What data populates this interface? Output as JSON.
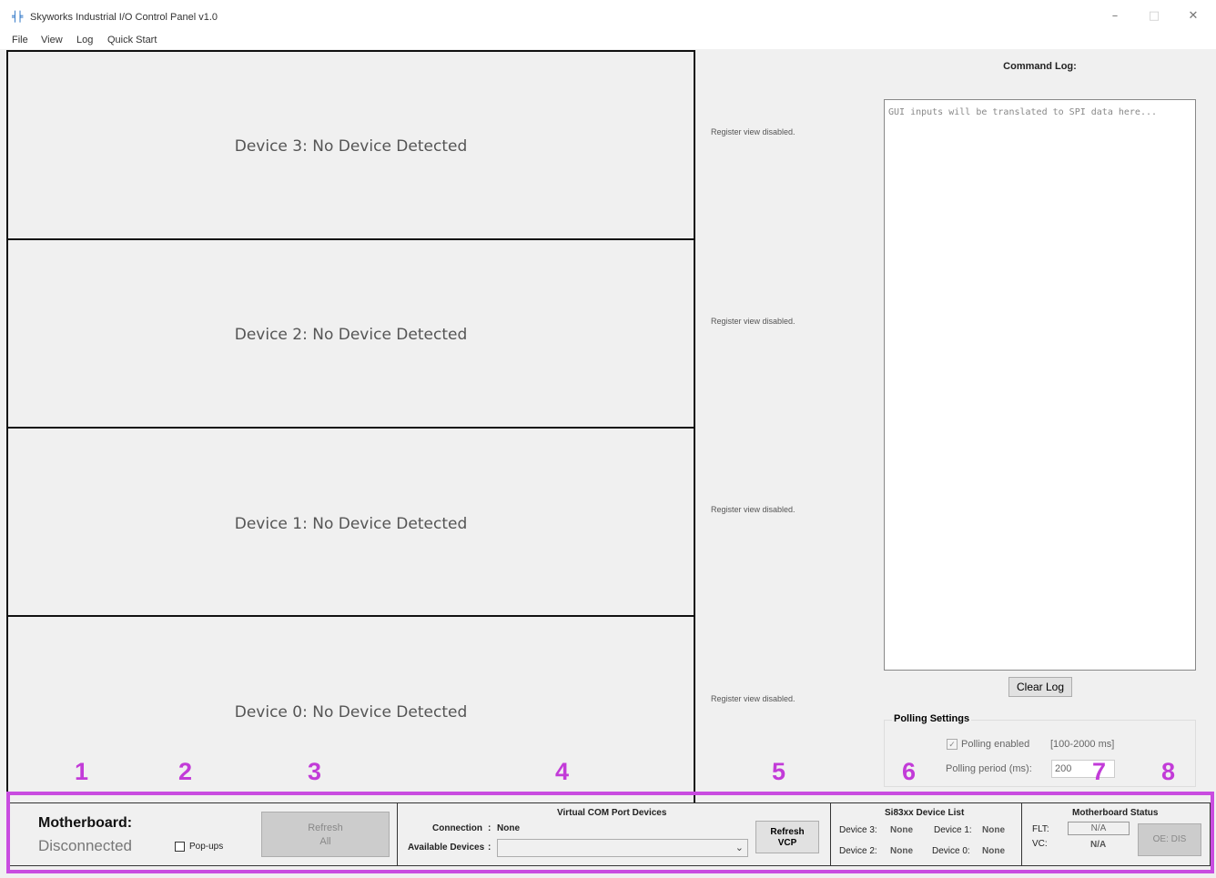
{
  "window": {
    "title": "Skyworks Industrial I/O Control Panel v1.0",
    "icon": "app-logo-icon",
    "controls": {
      "minimize": "–",
      "maximize": "□",
      "close": "✕"
    }
  },
  "menu": [
    "File",
    "View",
    "Log",
    "Quick Start"
  ],
  "devices": [
    {
      "label": "Device 3: No Device Detected",
      "register_text": "Register view disabled."
    },
    {
      "label": "Device 2: No Device Detected",
      "register_text": "Register view disabled."
    },
    {
      "label": "Device 1: No Device Detected",
      "register_text": "Register view disabled."
    },
    {
      "label": "Device 0: No Device Detected",
      "register_text": "Register view disabled."
    }
  ],
  "command_log": {
    "title": "Command Log:",
    "placeholder": "GUI inputs will be translated to SPI data here...",
    "clear_button": "Clear Log"
  },
  "polling": {
    "legend": "Polling Settings",
    "enabled_label": "Polling enabled",
    "enabled": true,
    "range": "[100-2000 ms]",
    "period_label": "Polling period (ms):",
    "period_value": "200"
  },
  "annotations": [
    "1",
    "2",
    "3",
    "4",
    "5",
    "6",
    "7",
    "8"
  ],
  "highlight_color": "#c94ce0",
  "status_bar": {
    "motherboard_label": "Motherboard:",
    "motherboard_state": "Disconnected",
    "popups_label": "Pop-ups",
    "refresh_all": [
      "Refresh",
      "All"
    ],
    "vcp": {
      "title": "Virtual COM Port Devices",
      "connection_label": "Connection",
      "connection_value": "None",
      "available_label": "Available Devices",
      "selected": "",
      "refresh": [
        "Refresh",
        "VCP"
      ]
    },
    "device_list": {
      "title": "Si83xx Device List",
      "items": [
        {
          "label": "Device 3:",
          "value": "None"
        },
        {
          "label": "Device 1:",
          "value": "None"
        },
        {
          "label": "Device 2:",
          "value": "None"
        },
        {
          "label": "Device 0:",
          "value": "None"
        }
      ]
    },
    "mb_status": {
      "title": "Motherboard Status",
      "flt_label": "FLT:",
      "flt_value": "N/A",
      "vc_label": "VC:",
      "vc_value": "N/A",
      "oe_button": "OE: DIS"
    }
  }
}
